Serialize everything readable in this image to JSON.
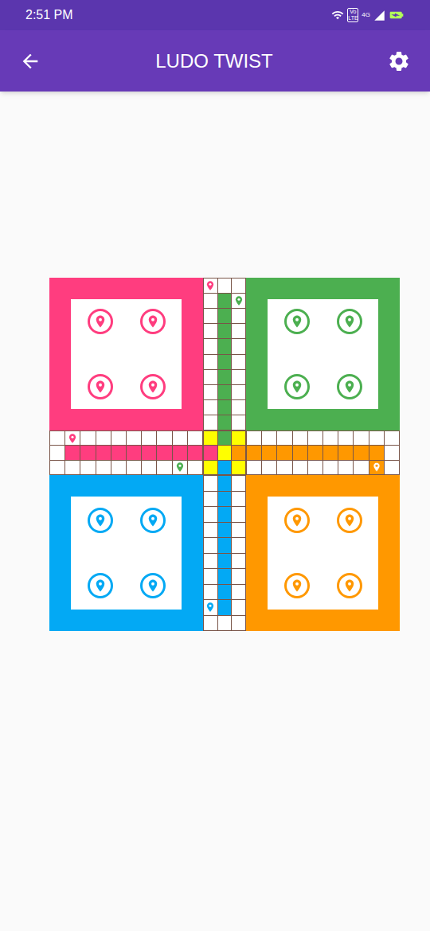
{
  "status_bar": {
    "time": "2:51 PM",
    "volte": "Vo LTE",
    "network": "4G"
  },
  "app_bar": {
    "title": "LUDO TWIST"
  },
  "board": {
    "center_color": "#ffff00",
    "homes": [
      {
        "player": "red",
        "color": "#ff3d7f",
        "tokens_at_home": 4
      },
      {
        "player": "green",
        "color": "#4caf50",
        "tokens_at_home": 4
      },
      {
        "player": "blue",
        "color": "#03a9f4",
        "tokens_at_home": 4
      },
      {
        "player": "orange",
        "color": "#ff9800",
        "tokens_at_home": 4
      }
    ],
    "home_paths": [
      {
        "arm": "top",
        "color": "#4caf50"
      },
      {
        "arm": "left",
        "color": "#ff3d7f"
      },
      {
        "arm": "right",
        "color": "#ff9800"
      },
      {
        "arm": "bottom",
        "color": "#03a9f4"
      }
    ],
    "pieces": [
      {
        "player": "red",
        "color": "#ff3d7f",
        "arm": "top",
        "row": 0,
        "col": 0,
        "cell_filled": false
      },
      {
        "player": "green",
        "color": "#4caf50",
        "arm": "top",
        "row": 1,
        "col": 2,
        "cell_filled": false
      },
      {
        "player": "red",
        "color": "#ff3d7f",
        "arm": "left",
        "row": 0,
        "col": 1,
        "cell_filled": false
      },
      {
        "player": "green",
        "color": "#4caf50",
        "arm": "left",
        "row": 2,
        "col": 8,
        "cell_filled": false
      },
      {
        "player": "orange",
        "color": "#ff9800",
        "arm": "right",
        "row": 2,
        "col": 8,
        "cell_filled": true
      },
      {
        "player": "blue",
        "color": "#03a9f4",
        "arm": "bottom",
        "row": 8,
        "col": 0,
        "cell_filled": false
      }
    ]
  }
}
